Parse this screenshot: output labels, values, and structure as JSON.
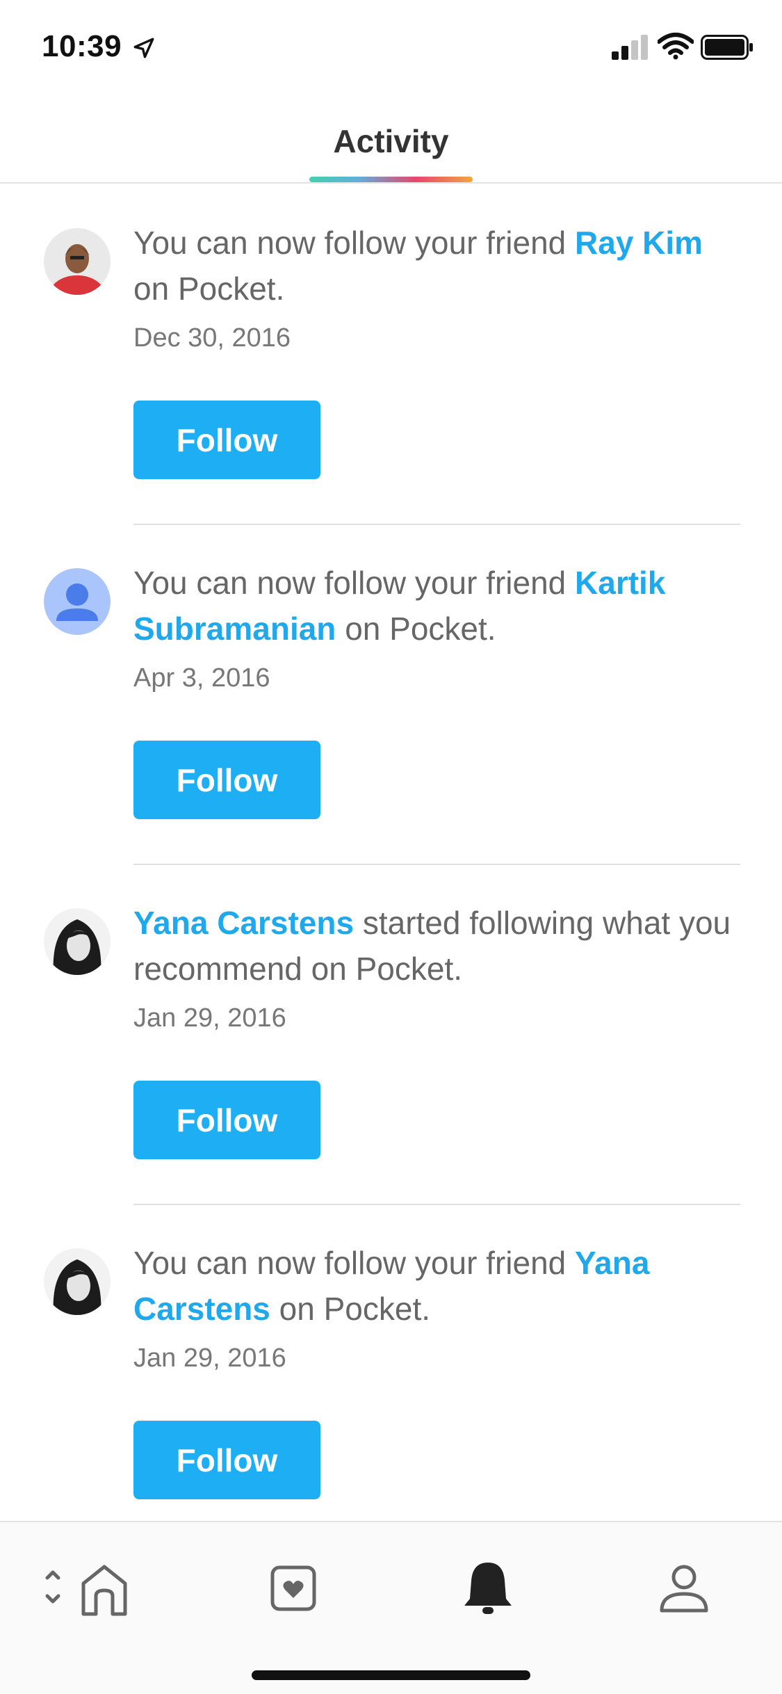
{
  "status_bar": {
    "time": "10:39"
  },
  "header": {
    "title": "Activity"
  },
  "feed": [
    {
      "name": "Ray Kim",
      "prefix": "You can now follow your friend ",
      "suffix": " on Pocket.",
      "date": "Dec 30, 2016",
      "button": "Follow",
      "avatar": "photo-red"
    },
    {
      "name": "Kartik Subramanian",
      "prefix": "You can now follow your friend ",
      "suffix": " on Pocket.",
      "date": "Apr 3, 2016",
      "button": "Follow",
      "avatar": "default-user"
    },
    {
      "name": "Yana Carstens",
      "prefix": "",
      "suffix": " started following what you recommend on Pocket.",
      "date": "Jan 29, 2016",
      "button": "Follow",
      "avatar": "photo-bw"
    },
    {
      "name": "Yana Carstens",
      "prefix": "You can now follow your friend ",
      "suffix": " on Pocket.",
      "date": "Jan 29, 2016",
      "button": "Follow",
      "avatar": "photo-bw"
    }
  ],
  "nav": {
    "items": [
      "home-icon",
      "saves-icon",
      "activity-bell-icon",
      "profile-icon"
    ],
    "active": "activity-bell-icon"
  },
  "colors": {
    "accent": "#1eaef4",
    "link": "#1fa8ec"
  }
}
